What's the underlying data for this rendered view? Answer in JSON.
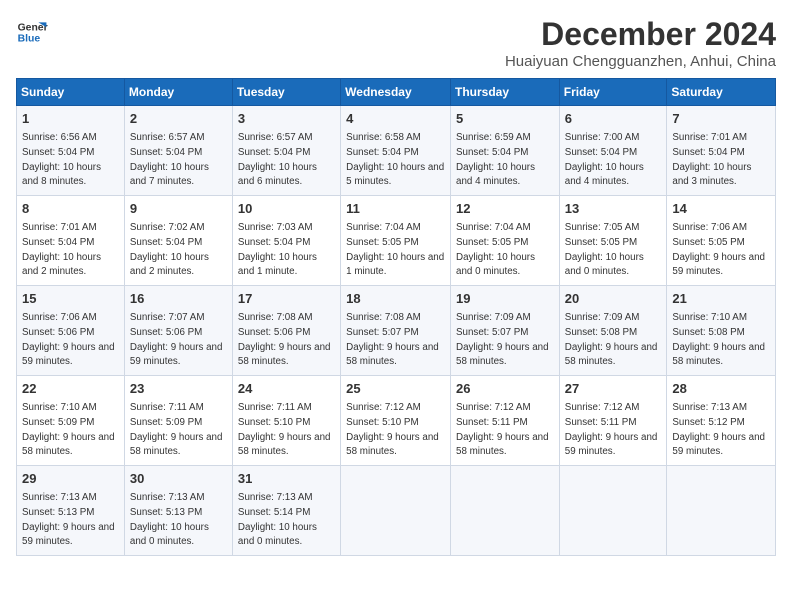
{
  "logo": {
    "line1": "General",
    "line2": "Blue"
  },
  "title": "December 2024",
  "location": "Huaiyuan Chengguanzhen, Anhui, China",
  "headers": [
    "Sunday",
    "Monday",
    "Tuesday",
    "Wednesday",
    "Thursday",
    "Friday",
    "Saturday"
  ],
  "weeks": [
    [
      {
        "day": "1",
        "sunrise": "6:56 AM",
        "sunset": "5:04 PM",
        "daylight": "10 hours and 8 minutes."
      },
      {
        "day": "2",
        "sunrise": "6:57 AM",
        "sunset": "5:04 PM",
        "daylight": "10 hours and 7 minutes."
      },
      {
        "day": "3",
        "sunrise": "6:57 AM",
        "sunset": "5:04 PM",
        "daylight": "10 hours and 6 minutes."
      },
      {
        "day": "4",
        "sunrise": "6:58 AM",
        "sunset": "5:04 PM",
        "daylight": "10 hours and 5 minutes."
      },
      {
        "day": "5",
        "sunrise": "6:59 AM",
        "sunset": "5:04 PM",
        "daylight": "10 hours and 4 minutes."
      },
      {
        "day": "6",
        "sunrise": "7:00 AM",
        "sunset": "5:04 PM",
        "daylight": "10 hours and 4 minutes."
      },
      {
        "day": "7",
        "sunrise": "7:01 AM",
        "sunset": "5:04 PM",
        "daylight": "10 hours and 3 minutes."
      }
    ],
    [
      {
        "day": "8",
        "sunrise": "7:01 AM",
        "sunset": "5:04 PM",
        "daylight": "10 hours and 2 minutes."
      },
      {
        "day": "9",
        "sunrise": "7:02 AM",
        "sunset": "5:04 PM",
        "daylight": "10 hours and 2 minutes."
      },
      {
        "day": "10",
        "sunrise": "7:03 AM",
        "sunset": "5:04 PM",
        "daylight": "10 hours and 1 minute."
      },
      {
        "day": "11",
        "sunrise": "7:04 AM",
        "sunset": "5:05 PM",
        "daylight": "10 hours and 1 minute."
      },
      {
        "day": "12",
        "sunrise": "7:04 AM",
        "sunset": "5:05 PM",
        "daylight": "10 hours and 0 minutes."
      },
      {
        "day": "13",
        "sunrise": "7:05 AM",
        "sunset": "5:05 PM",
        "daylight": "10 hours and 0 minutes."
      },
      {
        "day": "14",
        "sunrise": "7:06 AM",
        "sunset": "5:05 PM",
        "daylight": "9 hours and 59 minutes."
      }
    ],
    [
      {
        "day": "15",
        "sunrise": "7:06 AM",
        "sunset": "5:06 PM",
        "daylight": "9 hours and 59 minutes."
      },
      {
        "day": "16",
        "sunrise": "7:07 AM",
        "sunset": "5:06 PM",
        "daylight": "9 hours and 59 minutes."
      },
      {
        "day": "17",
        "sunrise": "7:08 AM",
        "sunset": "5:06 PM",
        "daylight": "9 hours and 58 minutes."
      },
      {
        "day": "18",
        "sunrise": "7:08 AM",
        "sunset": "5:07 PM",
        "daylight": "9 hours and 58 minutes."
      },
      {
        "day": "19",
        "sunrise": "7:09 AM",
        "sunset": "5:07 PM",
        "daylight": "9 hours and 58 minutes."
      },
      {
        "day": "20",
        "sunrise": "7:09 AM",
        "sunset": "5:08 PM",
        "daylight": "9 hours and 58 minutes."
      },
      {
        "day": "21",
        "sunrise": "7:10 AM",
        "sunset": "5:08 PM",
        "daylight": "9 hours and 58 minutes."
      }
    ],
    [
      {
        "day": "22",
        "sunrise": "7:10 AM",
        "sunset": "5:09 PM",
        "daylight": "9 hours and 58 minutes."
      },
      {
        "day": "23",
        "sunrise": "7:11 AM",
        "sunset": "5:09 PM",
        "daylight": "9 hours and 58 minutes."
      },
      {
        "day": "24",
        "sunrise": "7:11 AM",
        "sunset": "5:10 PM",
        "daylight": "9 hours and 58 minutes."
      },
      {
        "day": "25",
        "sunrise": "7:12 AM",
        "sunset": "5:10 PM",
        "daylight": "9 hours and 58 minutes."
      },
      {
        "day": "26",
        "sunrise": "7:12 AM",
        "sunset": "5:11 PM",
        "daylight": "9 hours and 58 minutes."
      },
      {
        "day": "27",
        "sunrise": "7:12 AM",
        "sunset": "5:11 PM",
        "daylight": "9 hours and 59 minutes."
      },
      {
        "day": "28",
        "sunrise": "7:13 AM",
        "sunset": "5:12 PM",
        "daylight": "9 hours and 59 minutes."
      }
    ],
    [
      {
        "day": "29",
        "sunrise": "7:13 AM",
        "sunset": "5:13 PM",
        "daylight": "9 hours and 59 minutes."
      },
      {
        "day": "30",
        "sunrise": "7:13 AM",
        "sunset": "5:13 PM",
        "daylight": "10 hours and 0 minutes."
      },
      {
        "day": "31",
        "sunrise": "7:13 AM",
        "sunset": "5:14 PM",
        "daylight": "10 hours and 0 minutes."
      },
      null,
      null,
      null,
      null
    ]
  ]
}
